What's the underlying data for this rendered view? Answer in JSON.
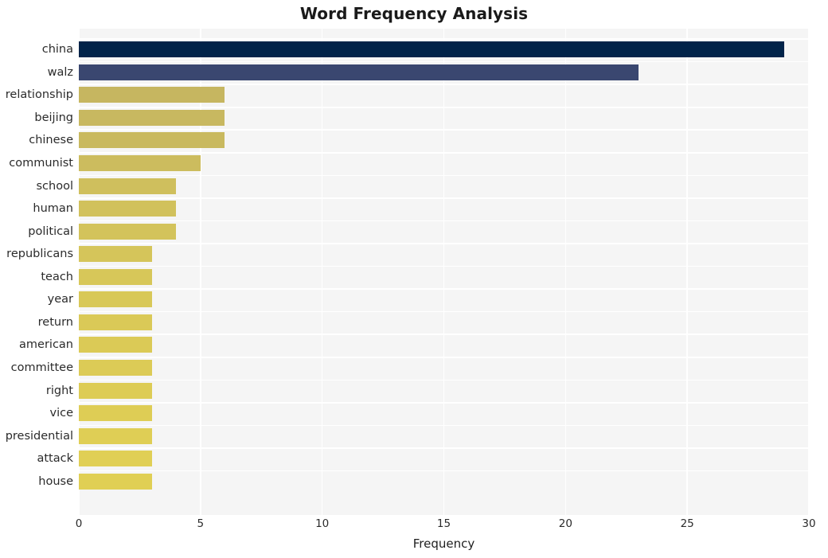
{
  "chart_data": {
    "type": "bar",
    "orientation": "horizontal",
    "title": "Word Frequency Analysis",
    "xlabel": "Frequency",
    "ylabel": "",
    "xlim": [
      0,
      30
    ],
    "xticks": [
      0,
      5,
      10,
      15,
      20,
      25,
      30
    ],
    "xtick_labels": [
      "0",
      "5",
      "10",
      "15",
      "20",
      "25",
      "30"
    ],
    "grid": true,
    "legend": "none",
    "categories": [
      "china",
      "walz",
      "relationship",
      "beijing",
      "chinese",
      "communist",
      "school",
      "human",
      "political",
      "republicans",
      "teach",
      "year",
      "return",
      "american",
      "committee",
      "right",
      "vice",
      "presidential",
      "attack",
      "house"
    ],
    "values": [
      29,
      23,
      6,
      6,
      6,
      5,
      4,
      4,
      4,
      3,
      3,
      3,
      3,
      3,
      3,
      3,
      3,
      3,
      3,
      3
    ],
    "bar_colors": [
      "#012349",
      "#3a4770",
      "#c6b660",
      "#c8b860",
      "#c9b95f",
      "#ccbc5e",
      "#cfbf5d",
      "#d1c15c",
      "#d3c35b",
      "#d5c55a",
      "#d7c759",
      "#d8c858",
      "#dac957",
      "#dbca56",
      "#dccb56",
      "#ddcc55",
      "#decd55",
      "#dfce55",
      "#e0cf55",
      "#e0cf54"
    ]
  },
  "axes": {
    "plot_background": "#f5f5f5",
    "gridline_color": "#ffffff",
    "figure_background": "#ffffff"
  }
}
